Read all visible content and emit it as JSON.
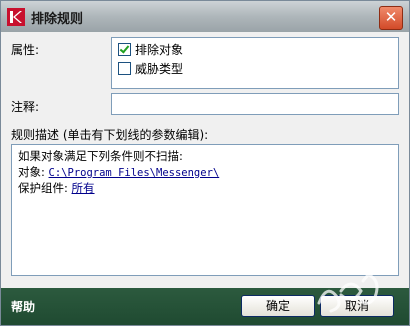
{
  "window": {
    "title": "排除规则",
    "close_symbol": "✕"
  },
  "form": {
    "properties_label": "属性:",
    "properties": [
      {
        "label": "排除对象",
        "checked": true
      },
      {
        "label": "威胁类型",
        "checked": false
      }
    ],
    "comment_label": "注释:",
    "comment_value": "",
    "description_label": "规则描述 (单击有下划线的参数编辑):"
  },
  "description": {
    "line1": "如果对象满足下列条件则不扫描:",
    "object_label": "对象:",
    "object_path": "C:\\Program Files\\Messenger\\",
    "component_label": "保护组件:",
    "component_value": "所有"
  },
  "footer": {
    "help": "帮助",
    "ok": "确定",
    "cancel": "取消"
  },
  "colors": {
    "footer_bg": "#1f4a31",
    "title_bg": "#aeb6ba",
    "close_bg": "#d24a28"
  }
}
